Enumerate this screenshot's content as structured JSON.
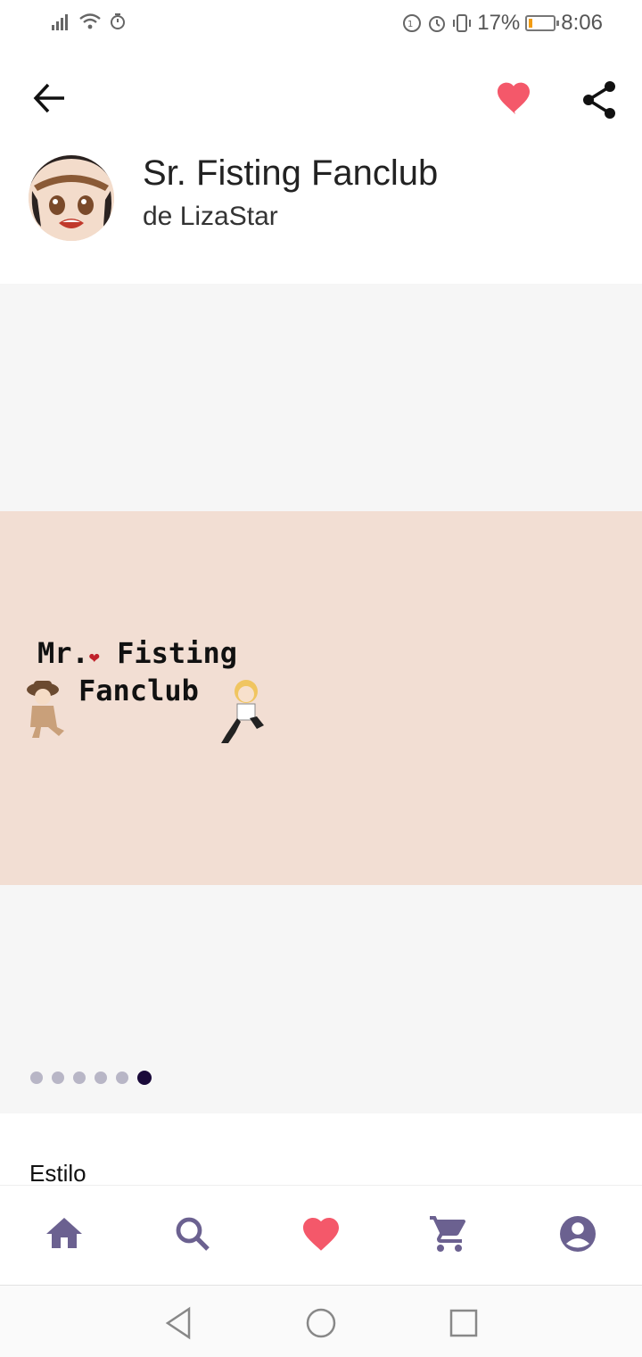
{
  "status_bar": {
    "battery_percent": "17%",
    "battery_level": 0.17,
    "time": "8:06"
  },
  "app_bar": {
    "icons": [
      "back-arrow-icon",
      "heart-icon",
      "share-icon"
    ],
    "heart_color": "#f4586a"
  },
  "header": {
    "title": "Sr. Fisting Fanclub",
    "subtitle": "de LizaStar"
  },
  "carousel": {
    "banner_line1": "Mr.",
    "banner_line1b": "Fisting",
    "banner_line2": "Fanclub",
    "page_count": 6,
    "active_index": 5,
    "banner_color": "#f2ded3"
  },
  "section": {
    "label": "Estilo"
  },
  "bottom_nav": {
    "items": [
      "home-icon",
      "search-icon",
      "heart-icon",
      "cart-icon",
      "account-icon"
    ],
    "icon_color": "#6b6190",
    "active_color": "#f4586a"
  },
  "system_nav": {
    "items": [
      "back-triangle-icon",
      "home-circle-icon",
      "recents-square-icon"
    ]
  }
}
